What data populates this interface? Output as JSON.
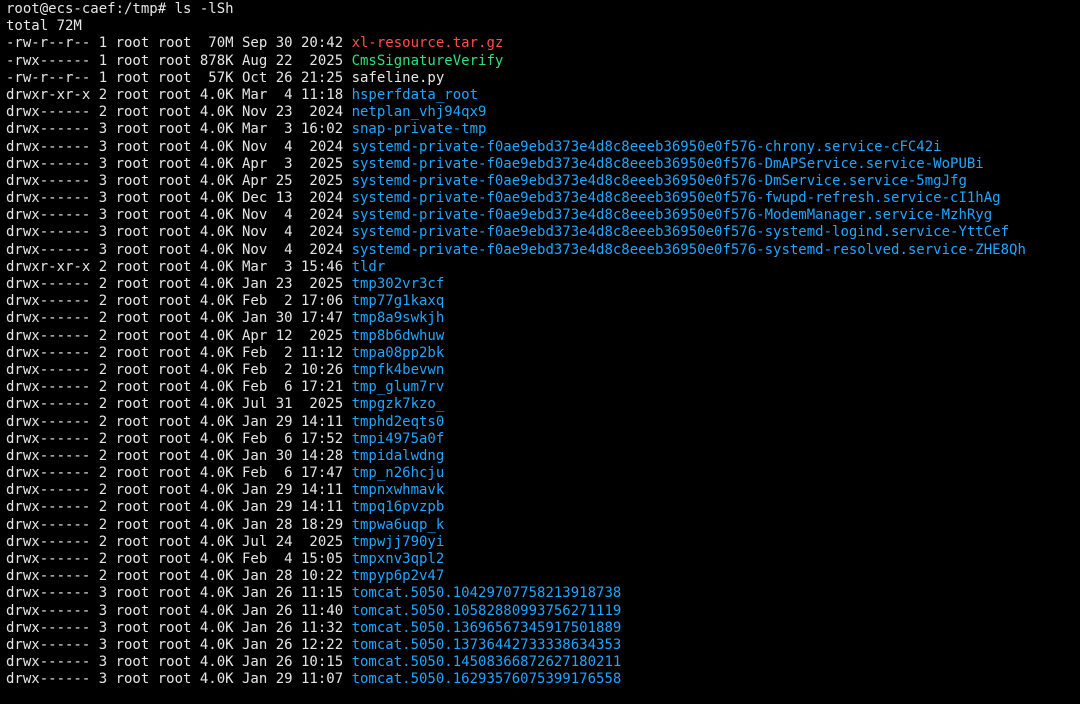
{
  "colors": {
    "background": "#000000",
    "text": "#e6e6e6",
    "archive": "#ff4d4d",
    "executable": "#2fe07a",
    "directory": "#1fa6ff"
  },
  "terminal": {
    "prompt": "root@ecs-caef:/tmp# ls -lSh",
    "total": "total 72M",
    "entries": [
      {
        "meta": "-rw-r--r-- 1 root root  70M Sep 30 20:42 ",
        "name": "xl-resource.tar.gz",
        "type": "archive"
      },
      {
        "meta": "-rwx------ 1 root root 878K Aug 22  2025 ",
        "name": "CmsSignatureVerify",
        "type": "exec"
      },
      {
        "meta": "-rw-r--r-- 1 root root  57K Oct 26 21:25 ",
        "name": "safeline.py",
        "type": "file"
      },
      {
        "meta": "drwxr-xr-x 2 root root 4.0K Mar  4 11:18 ",
        "name": "hsperfdata_root",
        "type": "dir"
      },
      {
        "meta": "drwx------ 2 root root 4.0K Nov 23  2024 ",
        "name": "netplan_vhj94qx9",
        "type": "dir"
      },
      {
        "meta": "drwx------ 3 root root 4.0K Mar  3 16:02 ",
        "name": "snap-private-tmp",
        "type": "dir"
      },
      {
        "meta": "drwx------ 3 root root 4.0K Nov  4  2024 ",
        "name": "systemd-private-f0ae9ebd373e4d8c8eeeb36950e0f576-chrony.service-cFC42i",
        "type": "dir"
      },
      {
        "meta": "drwx------ 3 root root 4.0K Apr  3  2025 ",
        "name": "systemd-private-f0ae9ebd373e4d8c8eeeb36950e0f576-DmAPService.service-WoPUBi",
        "type": "dir"
      },
      {
        "meta": "drwx------ 3 root root 4.0K Apr 25  2025 ",
        "name": "systemd-private-f0ae9ebd373e4d8c8eeeb36950e0f576-DmService.service-5mgJfg",
        "type": "dir"
      },
      {
        "meta": "drwx------ 3 root root 4.0K Dec 13  2024 ",
        "name": "systemd-private-f0ae9ebd373e4d8c8eeeb36950e0f576-fwupd-refresh.service-cI1hAg",
        "type": "dir"
      },
      {
        "meta": "drwx------ 3 root root 4.0K Nov  4  2024 ",
        "name": "systemd-private-f0ae9ebd373e4d8c8eeeb36950e0f576-ModemManager.service-MzhRyg",
        "type": "dir"
      },
      {
        "meta": "drwx------ 3 root root 4.0K Nov  4  2024 ",
        "name": "systemd-private-f0ae9ebd373e4d8c8eeeb36950e0f576-systemd-logind.service-YttCef",
        "type": "dir"
      },
      {
        "meta": "drwx------ 3 root root 4.0K Nov  4  2024 ",
        "name": "systemd-private-f0ae9ebd373e4d8c8eeeb36950e0f576-systemd-resolved.service-ZHE8Qh",
        "type": "dir"
      },
      {
        "meta": "drwxr-xr-x 2 root root 4.0K Mar  3 15:46 ",
        "name": "tldr",
        "type": "dir"
      },
      {
        "meta": "drwx------ 2 root root 4.0K Jan 23  2025 ",
        "name": "tmp302vr3cf",
        "type": "dir"
      },
      {
        "meta": "drwx------ 2 root root 4.0K Feb  2 17:06 ",
        "name": "tmp77g1kaxq",
        "type": "dir"
      },
      {
        "meta": "drwx------ 2 root root 4.0K Jan 30 17:47 ",
        "name": "tmp8a9swkjh",
        "type": "dir"
      },
      {
        "meta": "drwx------ 2 root root 4.0K Apr 12  2025 ",
        "name": "tmp8b6dwhuw",
        "type": "dir"
      },
      {
        "meta": "drwx------ 2 root root 4.0K Feb  2 11:12 ",
        "name": "tmpa08pp2bk",
        "type": "dir"
      },
      {
        "meta": "drwx------ 2 root root 4.0K Feb  2 10:26 ",
        "name": "tmpfk4bevwn",
        "type": "dir"
      },
      {
        "meta": "drwx------ 2 root root 4.0K Feb  6 17:21 ",
        "name": "tmp_glum7rv",
        "type": "dir"
      },
      {
        "meta": "drwx------ 2 root root 4.0K Jul 31  2025 ",
        "name": "tmpgzk7kzo_",
        "type": "dir"
      },
      {
        "meta": "drwx------ 2 root root 4.0K Jan 29 14:11 ",
        "name": "tmphd2eqts0",
        "type": "dir"
      },
      {
        "meta": "drwx------ 2 root root 4.0K Feb  6 17:52 ",
        "name": "tmpi4975a0f",
        "type": "dir"
      },
      {
        "meta": "drwx------ 2 root root 4.0K Jan 30 14:28 ",
        "name": "tmpidalwdng",
        "type": "dir"
      },
      {
        "meta": "drwx------ 2 root root 4.0K Feb  6 17:47 ",
        "name": "tmp_n26hcju",
        "type": "dir"
      },
      {
        "meta": "drwx------ 2 root root 4.0K Jan 29 14:11 ",
        "name": "tmpnxwhmavk",
        "type": "dir"
      },
      {
        "meta": "drwx------ 2 root root 4.0K Jan 29 14:11 ",
        "name": "tmpq16pvzpb",
        "type": "dir"
      },
      {
        "meta": "drwx------ 2 root root 4.0K Jan 28 18:29 ",
        "name": "tmpwa6uqp_k",
        "type": "dir"
      },
      {
        "meta": "drwx------ 2 root root 4.0K Jul 24  2025 ",
        "name": "tmpwjj790yi",
        "type": "dir"
      },
      {
        "meta": "drwx------ 2 root root 4.0K Feb  4 15:05 ",
        "name": "tmpxnv3qpl2",
        "type": "dir"
      },
      {
        "meta": "drwx------ 2 root root 4.0K Jan 28 10:22 ",
        "name": "tmpyp6p2v47",
        "type": "dir"
      },
      {
        "meta": "drwx------ 3 root root 4.0K Jan 26 11:15 ",
        "name": "tomcat.5050.10429707758213918738",
        "type": "dir"
      },
      {
        "meta": "drwx------ 3 root root 4.0K Jan 26 11:40 ",
        "name": "tomcat.5050.10582880993756271119",
        "type": "dir"
      },
      {
        "meta": "drwx------ 3 root root 4.0K Jan 26 11:32 ",
        "name": "tomcat.5050.13696567345917501889",
        "type": "dir"
      },
      {
        "meta": "drwx------ 3 root root 4.0K Jan 26 12:22 ",
        "name": "tomcat.5050.13736442733338634353",
        "type": "dir"
      },
      {
        "meta": "drwx------ 3 root root 4.0K Jan 26 10:15 ",
        "name": "tomcat.5050.14508366872627180211",
        "type": "dir"
      },
      {
        "meta": "drwx------ 3 root root 4.0K Jan 29 11:07 ",
        "name": "tomcat.5050.16293576075399176558",
        "type": "dir"
      }
    ]
  }
}
